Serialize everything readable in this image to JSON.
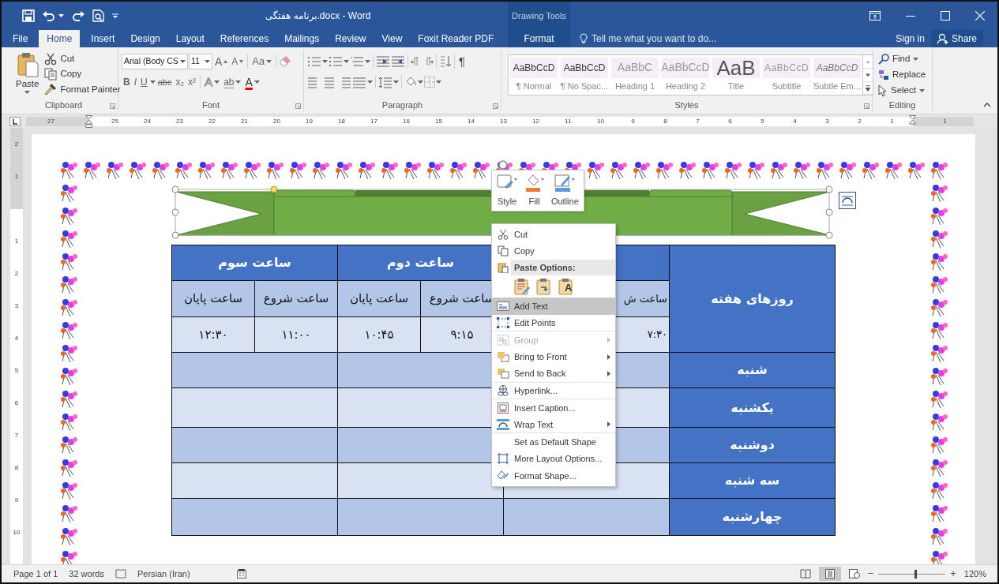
{
  "window": {
    "title": "برنامه هفتگی.docx - Word",
    "contextual_group": "Drawing Tools"
  },
  "tabs": [
    {
      "label": "File",
      "kind": "file",
      "selected": false
    },
    {
      "label": "Home",
      "kind": "standard",
      "selected": true
    },
    {
      "label": "Insert",
      "kind": "standard",
      "selected": false
    },
    {
      "label": "Design",
      "kind": "standard",
      "selected": false
    },
    {
      "label": "Layout",
      "kind": "standard",
      "selected": false
    },
    {
      "label": "References",
      "kind": "standard",
      "selected": false
    },
    {
      "label": "Mailings",
      "kind": "standard",
      "selected": false
    },
    {
      "label": "Review",
      "kind": "standard",
      "selected": false
    },
    {
      "label": "View",
      "kind": "standard",
      "selected": false
    },
    {
      "label": "Foxit Reader PDF",
      "kind": "standard",
      "selected": false
    },
    {
      "label": "Format",
      "kind": "contextual",
      "selected": false
    }
  ],
  "tell_me": {
    "placeholder": "Tell me what you want to do..."
  },
  "account": {
    "sign_in": "Sign in",
    "share": "Share"
  },
  "clipboard": {
    "title": "Clipboard",
    "paste": "Paste",
    "commands": [
      "Cut",
      "Copy",
      "Format Painter"
    ]
  },
  "font": {
    "title": "Font",
    "font_name": "Arial (Body CS",
    "font_size": "11",
    "grow": "A",
    "shrink": "A",
    "change_case": "Aa",
    "format_buttons": [
      "B",
      "I",
      "U",
      "abc",
      "x₂",
      "x²"
    ],
    "effects": "A",
    "highlight": "ab",
    "font_color": "A"
  },
  "paragraph": {
    "title": "Paragraph",
    "show_marks": "¶"
  },
  "styles": {
    "title": "Styles",
    "gallery": [
      {
        "preview": "AaBbCcD",
        "name": "¶ Normal",
        "kind": "normal"
      },
      {
        "preview": "AaBbCcD",
        "name": "¶ No Spac...",
        "kind": "normal"
      },
      {
        "preview": "AaBbC",
        "name": "Heading 1",
        "kind": "heading"
      },
      {
        "preview": "AaBbCcD",
        "name": "Heading 2",
        "kind": "heading"
      },
      {
        "preview": "AaB",
        "name": "Title",
        "kind": "title"
      },
      {
        "preview": "AaBbCcD",
        "name": "Subtitle",
        "kind": "subtitle"
      },
      {
        "preview": "AaBbCcD",
        "name": "Subtle Em...",
        "kind": "emphasis"
      }
    ]
  },
  "editing": {
    "title": "Editing",
    "commands": [
      "Find",
      "Replace",
      "Select"
    ]
  },
  "ruler": {
    "numbers": [
      "27",
      "25",
      "24",
      "23",
      "22",
      "21",
      "20",
      "19",
      "18",
      "17",
      "16",
      "15",
      "14",
      "13",
      "12",
      "11",
      "10",
      "9",
      "8",
      "7",
      "6",
      "5",
      "4",
      "3",
      "2",
      "1",
      "1"
    ]
  },
  "vertical_ruler": {
    "numbers": [
      "2",
      "1",
      "1",
      "2",
      "3",
      "4",
      "5",
      "6",
      "7",
      "8",
      "9",
      "10"
    ]
  },
  "table": {
    "corner_header": "روزهای هفته",
    "hour_groups": [
      {
        "start_label": "ساعت ش",
        "start_time": "۷:۳۰"
      },
      {
        "title": "ساعت دوم",
        "start_label": "ساعت شروع",
        "end_label": "ساعت پایان",
        "start_time": "۹:۱۵",
        "end_time": "۱۰:۴۵"
      },
      {
        "title": "ساعت سوم",
        "start_label": "ساعت شروع",
        "end_label": "ساعت پایان",
        "start_time": "۱۱:۰۰",
        "end_time": "۱۲:۳۰"
      }
    ],
    "days": [
      "شنبه",
      "یکشنبه",
      "دوشنبه",
      "سه شنبه",
      "چهارشنبه"
    ]
  },
  "mini_toolbar": {
    "buttons": [
      {
        "label": "Style"
      },
      {
        "label": "Fill"
      },
      {
        "label": "Outline"
      }
    ]
  },
  "context_menu": {
    "items": [
      {
        "kind": "command",
        "label": "Cut",
        "selected": false,
        "disabled": false,
        "has_submenu": false,
        "divider_after": false
      },
      {
        "kind": "command",
        "label": "Copy",
        "selected": false,
        "disabled": false,
        "has_submenu": false,
        "divider_after": false
      },
      {
        "kind": "header",
        "label": "Paste Options:"
      },
      {
        "kind": "paste_options",
        "text_glyph": "A"
      },
      {
        "kind": "command",
        "label": "Add Text",
        "selected": true,
        "disabled": false,
        "has_submenu": false,
        "divider_after": false
      },
      {
        "kind": "command",
        "label": "Edit Points",
        "selected": false,
        "disabled": false,
        "has_submenu": false,
        "divider_after": true
      },
      {
        "kind": "command",
        "label": "Group",
        "selected": false,
        "disabled": true,
        "has_submenu": true,
        "divider_after": false
      },
      {
        "kind": "command",
        "label": "Bring to Front",
        "selected": false,
        "disabled": false,
        "has_submenu": true,
        "divider_after": false
      },
      {
        "kind": "command",
        "label": "Send to Back",
        "selected": false,
        "disabled": false,
        "has_submenu": true,
        "divider_after": true
      },
      {
        "kind": "command",
        "label": "Hyperlink...",
        "selected": false,
        "disabled": false,
        "has_submenu": false,
        "divider_after": true
      },
      {
        "kind": "command",
        "label": "Insert Caption...",
        "selected": false,
        "disabled": false,
        "has_submenu": false,
        "divider_after": false
      },
      {
        "kind": "command",
        "label": "Wrap Text",
        "selected": false,
        "disabled": false,
        "has_submenu": true,
        "divider_after": true
      },
      {
        "kind": "command",
        "label": "Set as Default Shape",
        "selected": false,
        "disabled": false,
        "has_submenu": false,
        "divider_after": false
      },
      {
        "kind": "command",
        "label": "More Layout Options...",
        "selected": false,
        "disabled": false,
        "has_submenu": false,
        "divider_after": false
      },
      {
        "kind": "command",
        "label": "Format Shape...",
        "selected": false,
        "disabled": false,
        "has_submenu": false,
        "divider_after": false
      }
    ]
  },
  "status_bar": {
    "page": "Page 1 of 1",
    "words": "32 words",
    "language": "Persian (Iran)",
    "views": [
      {
        "selected": false
      },
      {
        "selected": true
      },
      {
        "selected": false
      }
    ],
    "zoom_out": "−",
    "zoom_slider": {
      "level": 0.55
    },
    "zoom_in": "+",
    "zoom": "120%"
  }
}
